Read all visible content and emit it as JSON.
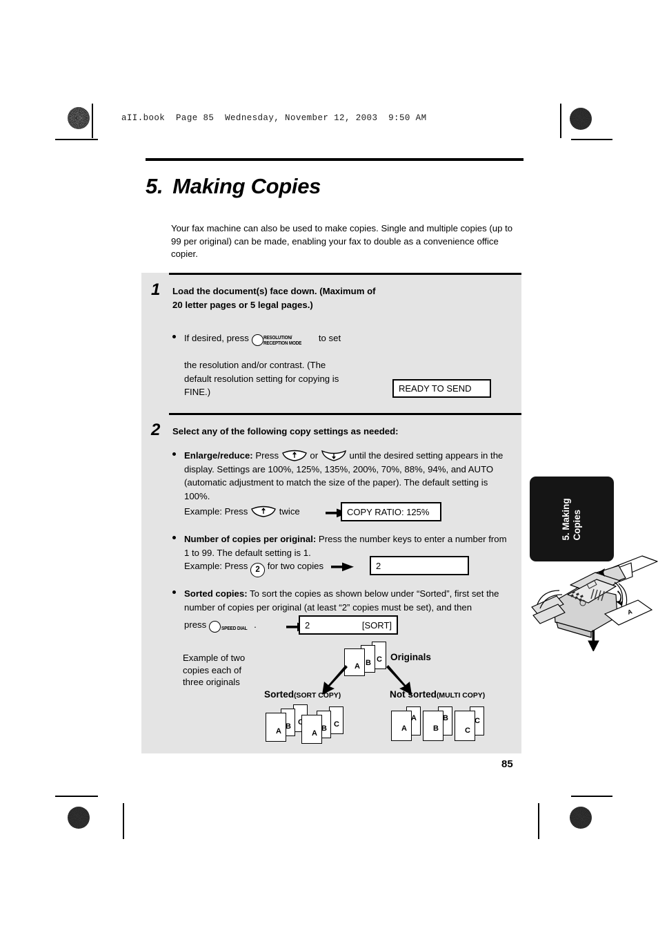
{
  "document": {
    "book_header": "aII.book  Page 85  Wednesday, November 12, 2003  9:50 AM",
    "page_number": "85",
    "side_tab_label": "5. Making\nCopies"
  },
  "chapter": {
    "number": "5.",
    "title": "Making Copies",
    "intro": "Your fax machine can also be used to make copies. Single and multiple copies (up to 99 per original) can be made, enabling your fax to double as a convenience office copier."
  },
  "steps": [
    {
      "number": "1",
      "heading": "Load the document(s) face down. (Maximum of 20 letter pages or 5 legal pages.)",
      "bullet_pre": "If desired, press",
      "bullet_post": "to set",
      "bullet_rest": "the resolution and/or contrast. (The default resolution setting for copying is FINE.)",
      "key_caption_line1": "RESOLUTION/",
      "key_caption_line2": "RECEPTION MODE",
      "display": "READY TO SEND"
    },
    {
      "number": "2",
      "heading": "Select any of the following copy settings as needed:",
      "bullets": [
        {
          "label": "Enlarge/reduce:",
          "text_a": "Press",
          "text_or": "or",
          "text_b": "until the desired setting appears in the display. Settings are 100%, 125%, 135%, 200%, 70%, 88%, 94%, and AUTO (automatic adjustment to match the size of the paper). The default setting is 100%.",
          "example_pre": "Example: Press",
          "example_post": "twice",
          "display": "COPY RATIO: 125%"
        },
        {
          "label": "Number of copies per original:",
          "text_b": "Press the number keys to enter a number from 1 to 99. The default setting is 1.",
          "example_pre": "Example: Press",
          "example_key": "2",
          "example_post": "for two copies",
          "display": "2"
        },
        {
          "label": "Sorted copies:",
          "text_b": "To sort the copies as shown below under “Sorted”, first set the number of copies per original (at least “2” copies must be set), and then",
          "example_pre": "press",
          "key_caption": "SPEED DIAL",
          "example_post": ".",
          "display_left": "2",
          "display_right": "[SORT]"
        }
      ]
    }
  ],
  "diagram": {
    "note": "Example of two copies each of three originals",
    "originals_label": "Originals",
    "sorted_label": "Sorted",
    "sorted_sub": "(SORT COPY)",
    "not_sorted_label": "Not sorted",
    "not_sorted_sub": "(MULTI COPY)",
    "originals_sheets": [
      "A",
      "B",
      "C"
    ],
    "sorted_sheets": [
      "A",
      "B",
      "C",
      "A",
      "B",
      "C"
    ],
    "not_sorted_sheets": [
      "A",
      "A",
      "B",
      "B",
      "C",
      "C"
    ]
  },
  "colors": {
    "panel_bg": "#e4e4e4",
    "tab_bg": "#151515",
    "ink": "#000000"
  }
}
